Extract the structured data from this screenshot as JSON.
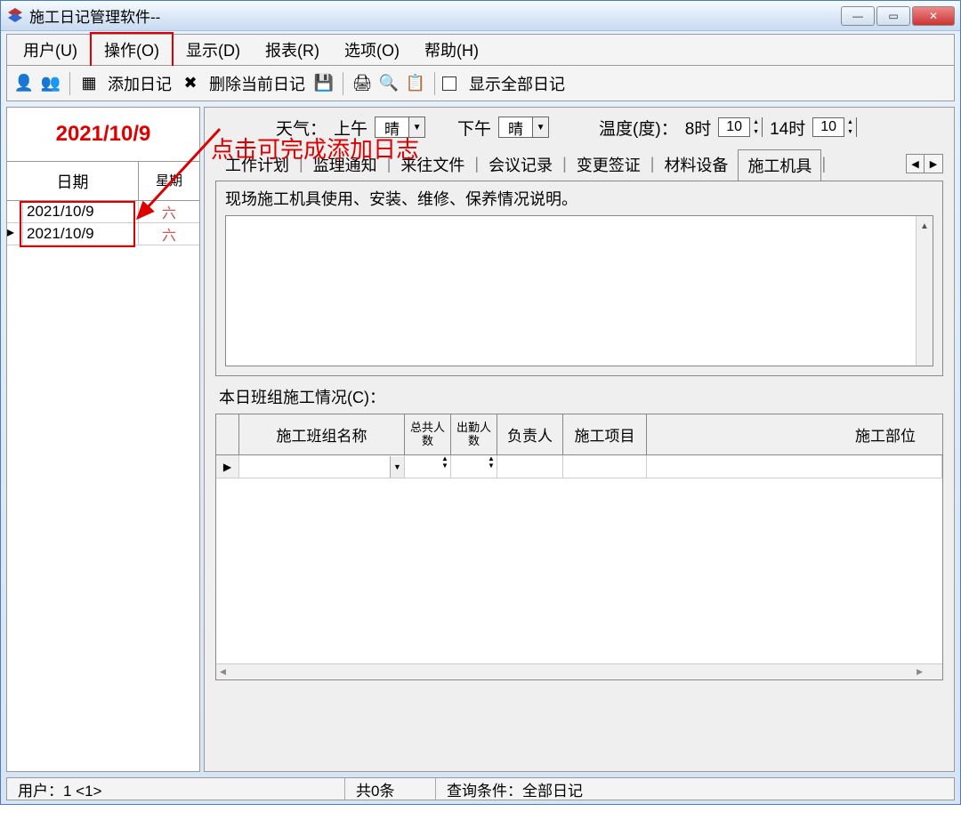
{
  "window": {
    "title": "施工日记管理软件--"
  },
  "menu": [
    "用户(U)",
    "操作(O)",
    "显示(D)",
    "报表(R)",
    "选项(O)",
    "帮助(H)"
  ],
  "toolbar": {
    "add_diary": "添加日记",
    "delete_diary": "删除当前日记",
    "show_all": "显示全部日记"
  },
  "left": {
    "big_date": "2021/10/9",
    "col_date": "日期",
    "col_week": "星期",
    "rows": [
      {
        "date": "2021/10/9",
        "wk": "六"
      },
      {
        "date": "2021/10/9",
        "wk": "六"
      }
    ]
  },
  "annotation": "点击可完成添加日志",
  "weather": {
    "label": "天气：",
    "am_label": "上午",
    "am_value": "晴",
    "pm_label": "下午",
    "pm_value": "晴",
    "temp_label": "温度(度)：",
    "t1_label": "8时",
    "t1_value": "10",
    "t2_label": "14时",
    "t2_value": "10"
  },
  "tabs": [
    "工作计划",
    "监理通知",
    "来往文件",
    "会议记录",
    "变更签证",
    "材料设备",
    "施工机具"
  ],
  "active_tab": "施工机具",
  "panel": {
    "title": "现场施工机具使用、安装、维修、保养情况说明。"
  },
  "crew": {
    "label": "本日班组施工情况(C)：",
    "cols": [
      "施工班组名称",
      "总共人数",
      "出勤人数",
      "负责人",
      "施工项目",
      "施工部位"
    ]
  },
  "status": {
    "user": "用户：1 <1>",
    "total": "共0条",
    "query": "查询条件：全部日记"
  }
}
